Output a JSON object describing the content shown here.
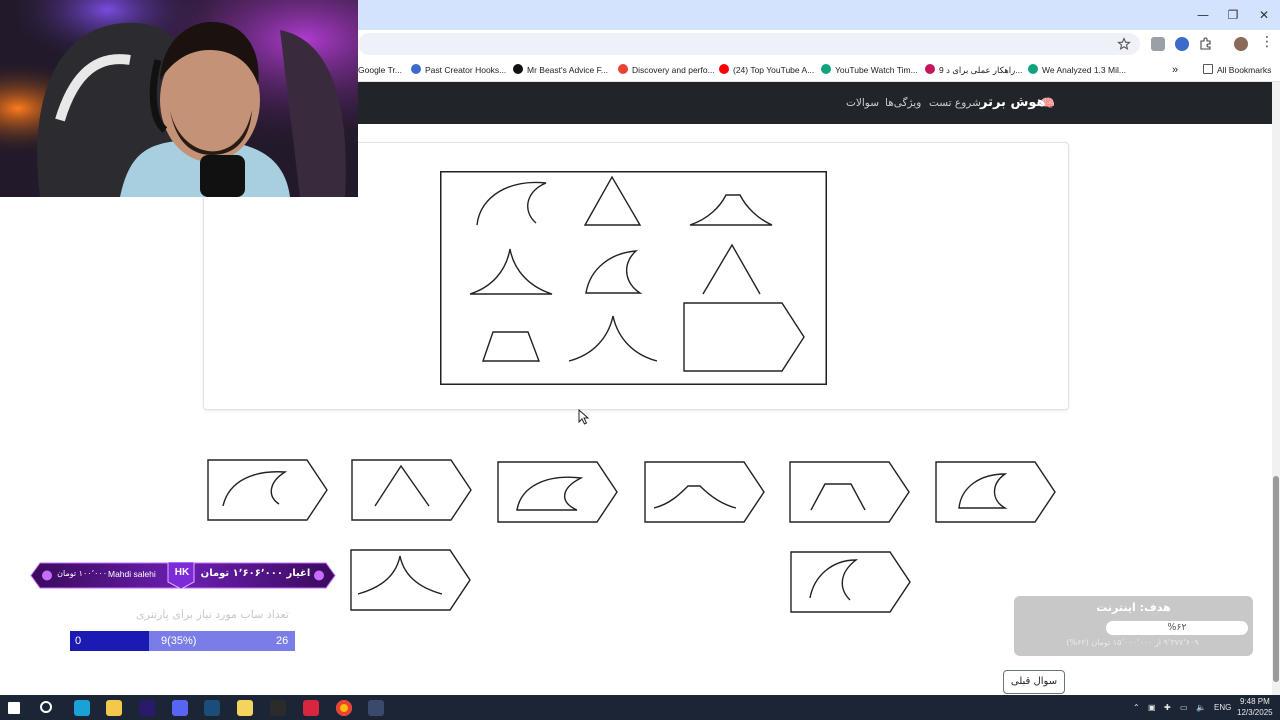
{
  "browser": {
    "window_controls": {
      "minimize": "—",
      "maximize": "❐",
      "close": "✕"
    },
    "bookmarks": [
      {
        "label": "Google Tr...",
        "icon": "google-translate-icon",
        "color": "#4a86e8"
      },
      {
        "label": "Past Creator Hooks...",
        "icon": "gh-icon",
        "color": "#3c6bc9"
      },
      {
        "label": "Mr Beast's Advice F...",
        "icon": "medium-icon",
        "color": "#111111"
      },
      {
        "label": "Discovery and perfo...",
        "icon": "google-icon",
        "color": "#ea4335"
      },
      {
        "label": "(24) Top YouTube A...",
        "icon": "youtube-icon",
        "color": "#ff0000"
      },
      {
        "label": "YouTube Watch Tim...",
        "icon": "chatgpt-icon",
        "color": "#10a37f"
      },
      {
        "label": "9 راهکار عملی برای د...",
        "icon": "bookmark-icon",
        "color": "#c2185b"
      },
      {
        "label": "We Analyzed 1.3 Mil...",
        "icon": "chatgpt-icon",
        "color": "#10a37f"
      }
    ],
    "more_bookmarks": "»",
    "all_bookmarks": "All Bookmarks"
  },
  "site_nav": {
    "brand": "هوش برتر",
    "brand_icon": "brain-icon",
    "links": [
      "شروع تست",
      "ویژگی‌ها",
      "سوالات"
    ]
  },
  "question": {
    "puzzle_cells": [
      "crescent-arc",
      "triangle",
      "bell-curve",
      "cusp-curve",
      "wave-fin",
      "triangle-open",
      "trapezoid",
      "cusp-open",
      "missing-pentagon"
    ],
    "answer_options": [
      {
        "id": "a",
        "shape": "crescent-arc"
      },
      {
        "id": "b",
        "shape": "triangle-open"
      },
      {
        "id": "c",
        "shape": "crescent-closed"
      },
      {
        "id": "d",
        "shape": "bell-curve"
      },
      {
        "id": "e",
        "shape": "trapezoid"
      },
      {
        "id": "f",
        "shape": "wave-fin"
      },
      {
        "id": "g",
        "shape": "cusp-curve"
      },
      {
        "id": "h",
        "shape": "wave-fin-open"
      }
    ]
  },
  "prev_button": "سوال قبلی",
  "goal_widget": {
    "title": "هدف: اینترنت",
    "percent_label": "%۶۲",
    "progress": 0.62,
    "detail": "۹٬۳۷۷٬۶۰۹ از ۱۵٬۰۰۰٬۰۰۰ تومان (۶۲%)"
  },
  "donation_overlay": {
    "badge": "HK",
    "headline": "اغیار ۱٬۶۰۶٬۰۰۰ تومان",
    "donor": "Mahdi salehi",
    "amount": "۱۰۰٬۰۰۰ تومان",
    "target_text": "تعداد ساب مورد نیاز برای پارتنری",
    "bar_min": "0",
    "bar_value": "9(35%)",
    "bar_max": "26",
    "progress": 0.35
  },
  "taskbar": {
    "lang": "ENG",
    "time": "9:48 PM",
    "date": "12/3/2025",
    "apps": [
      {
        "icon": "windows-start-icon",
        "color": "#ffffff"
      },
      {
        "icon": "search-icon",
        "color": "#ffffff"
      },
      {
        "icon": "edge-icon",
        "color": "#1aa2d8"
      },
      {
        "icon": "file-explorer-icon",
        "color": "#f2c94c"
      },
      {
        "icon": "premiere-icon",
        "color": "#2a1a6b"
      },
      {
        "icon": "discord-icon",
        "color": "#5865f2"
      },
      {
        "icon": "steam-icon",
        "color": "#1b4d7a"
      },
      {
        "icon": "notes-icon",
        "color": "#f4d35e"
      },
      {
        "icon": "obs-icon",
        "color": "#2b2b2b"
      },
      {
        "icon": "app-red-icon",
        "color": "#d7263d"
      },
      {
        "icon": "chrome-icon",
        "color": "#fbbc05"
      },
      {
        "icon": "terminal-icon",
        "color": "#3a4a6b"
      }
    ]
  }
}
